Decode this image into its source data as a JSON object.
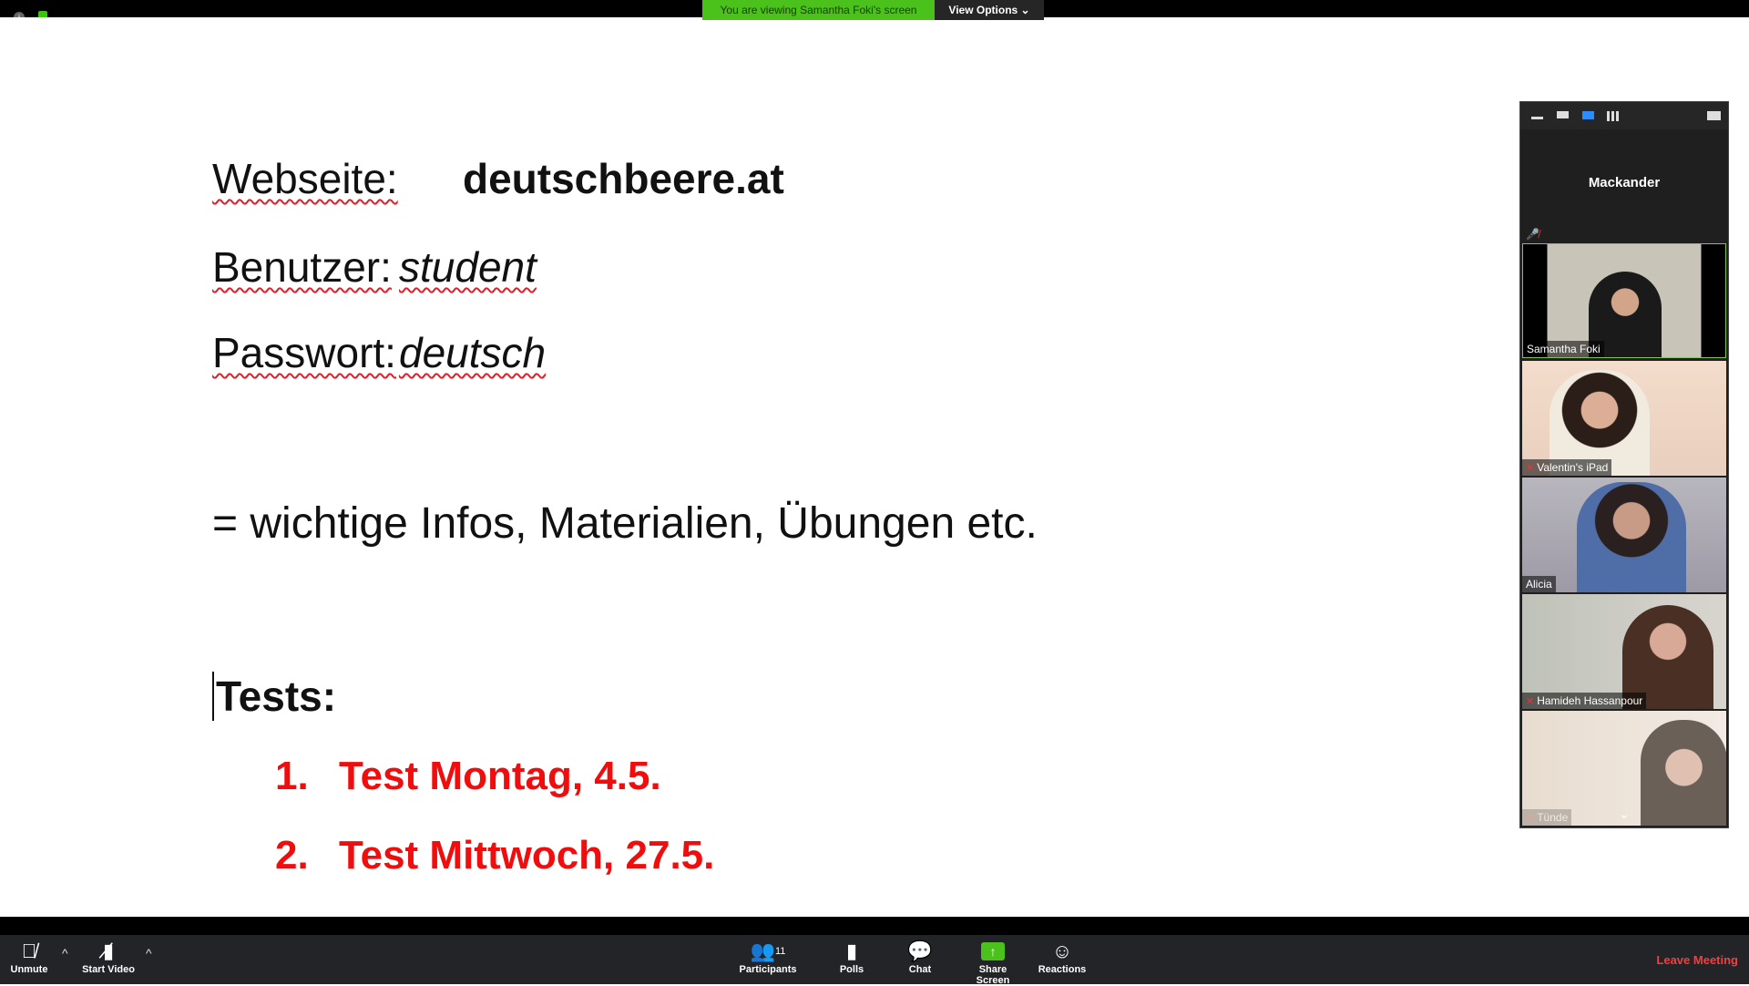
{
  "top_bar": {
    "viewing_banner": "You are viewing Samantha Foki's screen",
    "view_options": "View Options ⌄",
    "banner_color": "#4bc11b"
  },
  "slide": {
    "website_label": "Webseite:",
    "website_value": "deutschbeere.at",
    "user_label": "Benutzer:",
    "user_value": "student",
    "password_label": "Passwort:",
    "password_value": "deutsch",
    "info_line": "= wichtige Infos, Materialien, Übungen etc.",
    "tests_heading": "Tests:",
    "tests": [
      {
        "num": "1.",
        "text": "Test Montag, 4.5."
      },
      {
        "num": "2.",
        "text": "Test Mittwoch, 27.5."
      }
    ]
  },
  "panel": {
    "self_name": "Mackander",
    "participants": [
      {
        "name": "Samantha Foki",
        "muted": false,
        "active": true
      },
      {
        "name": "Valentin's iPad",
        "muted": true
      },
      {
        "name": "Alicia",
        "muted": false
      },
      {
        "name": "Hamideh Hassanpour",
        "muted": true
      },
      {
        "name": "Tünde",
        "muted": true
      }
    ]
  },
  "toolbar": {
    "unmute": "Unmute",
    "start_video": "Start Video",
    "participants": "Participants",
    "participants_count": "11",
    "polls": "Polls",
    "chat": "Chat",
    "share_screen": "Share Screen",
    "reactions": "Reactions",
    "leave": "Leave Meeting",
    "leave_color": "#f04040"
  }
}
